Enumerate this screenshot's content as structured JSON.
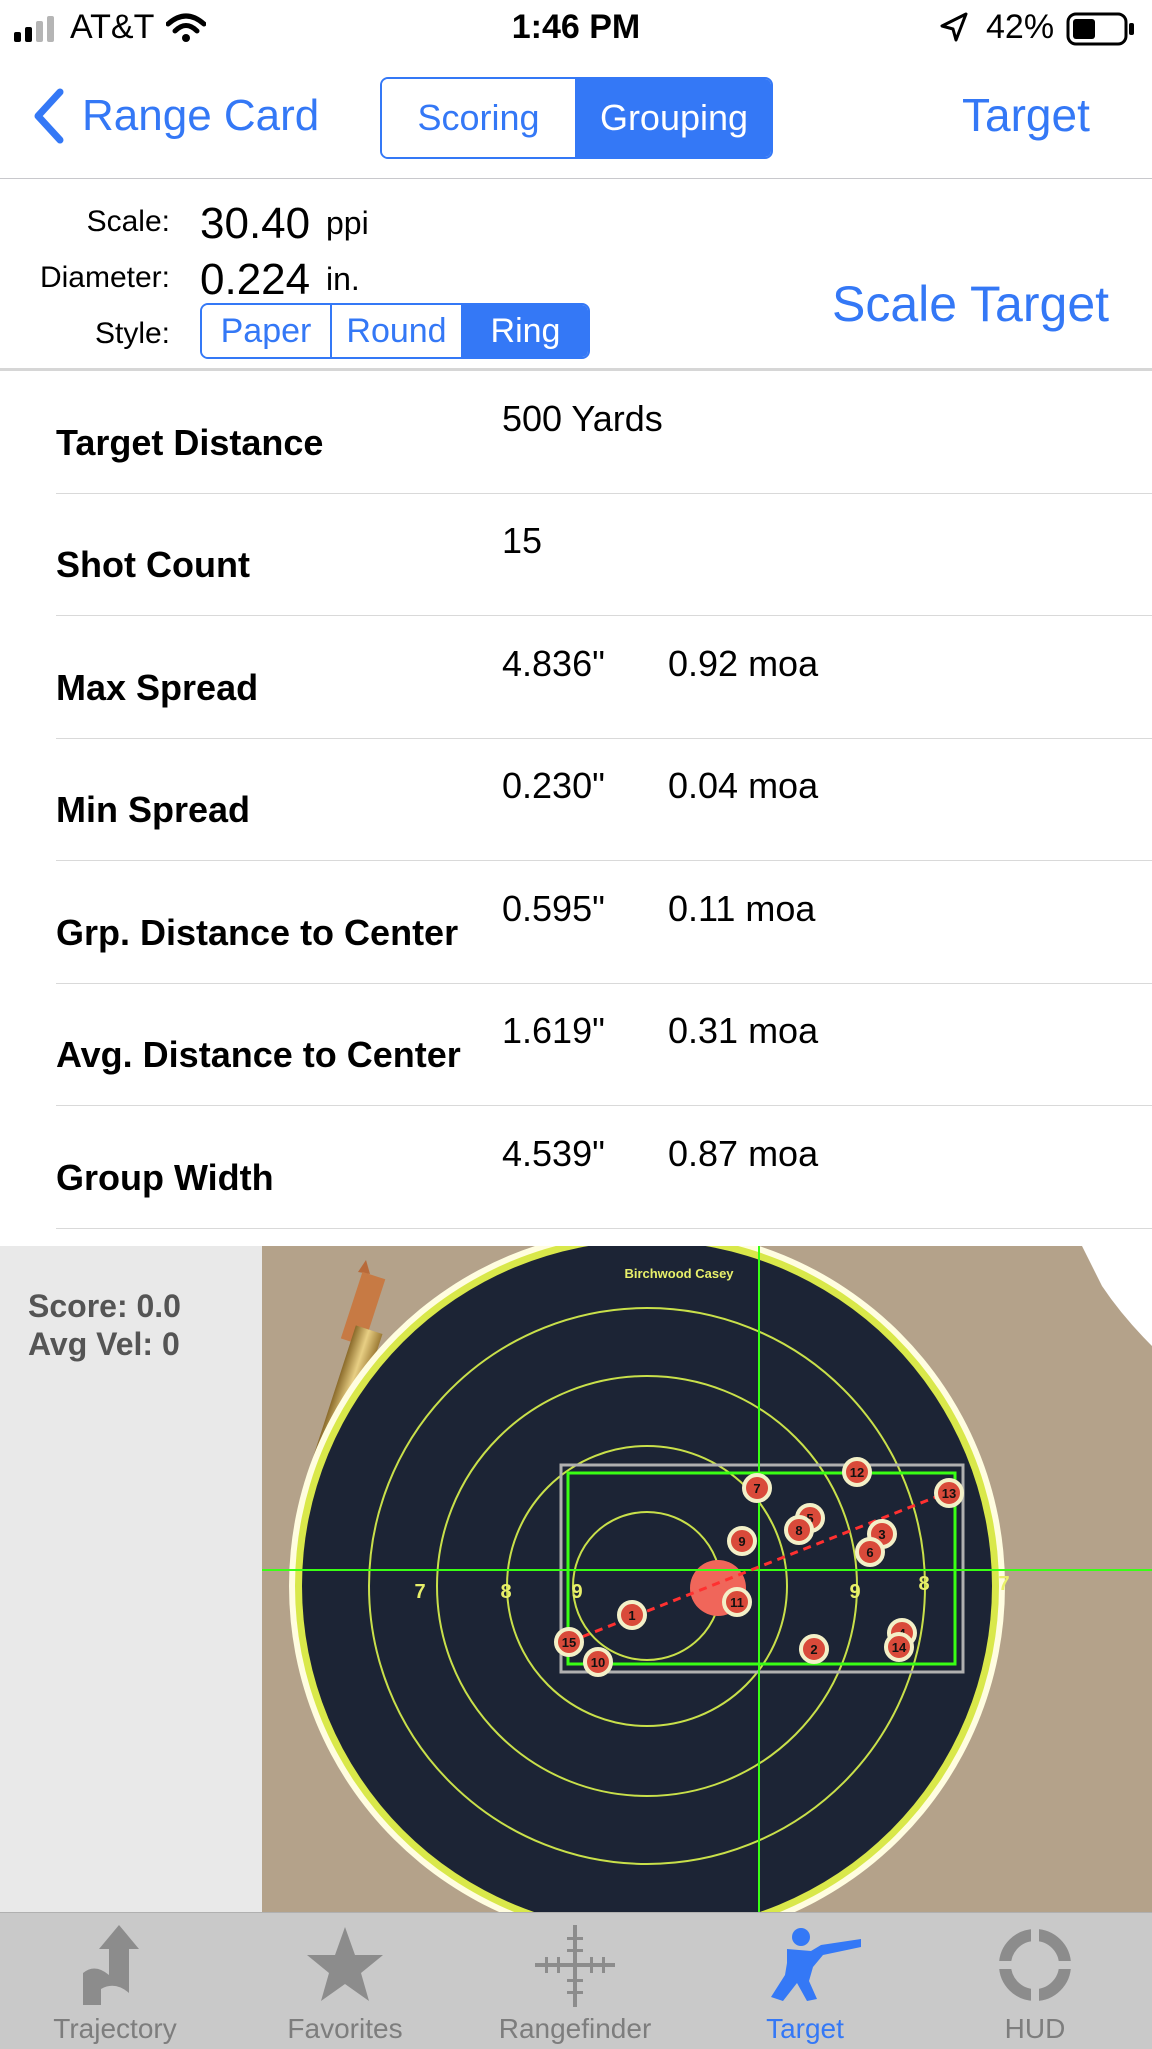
{
  "status_bar": {
    "carrier": "AT&T",
    "time": "1:46 PM",
    "battery": "42%"
  },
  "nav": {
    "back_label": "Range Card",
    "segments": [
      "Scoring",
      "Grouping"
    ],
    "selected_segment": "Grouping",
    "right_label": "Target"
  },
  "scale_panel": {
    "scale_label": "Scale:",
    "scale_value": "30.40",
    "scale_unit": "ppi",
    "diameter_label": "Diameter:",
    "diameter_value": "0.224",
    "diameter_unit": "in.",
    "style_label": "Style:",
    "style_options": [
      "Paper",
      "Round",
      "Ring"
    ],
    "selected_style": "Ring",
    "scale_target_label": "Scale Target"
  },
  "stats": [
    {
      "label": "Target Distance",
      "value": "500 Yards",
      "moa": ""
    },
    {
      "label": "Shot Count",
      "value": "15",
      "moa": ""
    },
    {
      "label": "Max Spread",
      "value": "4.836\"",
      "moa": "0.92 moa"
    },
    {
      "label": "Min Spread",
      "value": "0.230\"",
      "moa": "0.04 moa"
    },
    {
      "label": "Grp. Distance to Center",
      "value": "0.595\"",
      "moa": "0.11 moa"
    },
    {
      "label": "Avg. Distance to Center",
      "value": "1.619\"",
      "moa": "0.31 moa"
    },
    {
      "label": "Group Width",
      "value": "4.539\"",
      "moa": "0.87 moa"
    }
  ],
  "target_view": {
    "score_text": "Score: 0.0",
    "avg_vel_text": "Avg Vel: 0",
    "brand_text": "Birchwood Casey",
    "ring_numbers": [
      "7",
      "8",
      "9",
      "9",
      "8",
      "7"
    ],
    "shot_labels": [
      "1",
      "2",
      "3",
      "4",
      "5",
      "6",
      "7",
      "8",
      "9",
      "10",
      "11",
      "12",
      "13",
      "14",
      "15"
    ]
  },
  "tabs": [
    {
      "label": "Trajectory",
      "icon": "trajectory-icon"
    },
    {
      "label": "Favorites",
      "icon": "star-icon"
    },
    {
      "label": "Rangefinder",
      "icon": "crosshair-icon"
    },
    {
      "label": "Target",
      "icon": "rifleman-icon"
    },
    {
      "label": "HUD",
      "icon": "hud-ring-icon"
    }
  ],
  "active_tab": "Target",
  "colors": {
    "accent": "#3478f6",
    "overlay_green": "#39ff14",
    "group_line": "#ff3030",
    "bullseye": "#f0665a"
  }
}
